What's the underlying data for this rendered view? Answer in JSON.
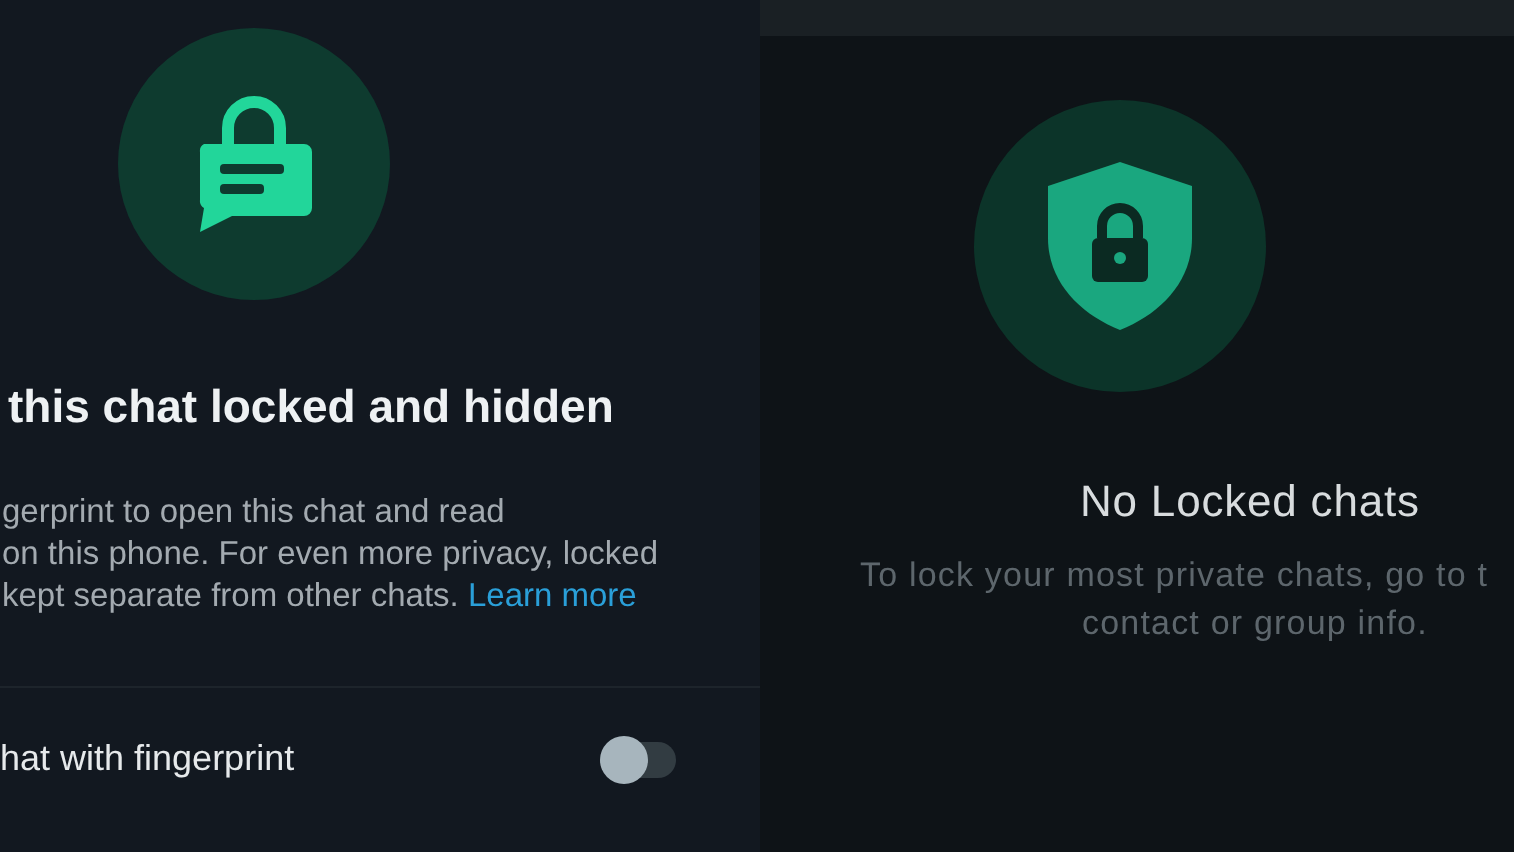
{
  "lock_settings": {
    "title": "this chat locked and hidden",
    "description_lines": [
      "gerprint to open this chat and read",
      "on this phone. For even more privacy, locked",
      "kept separate from other chats."
    ],
    "link": "Learn more",
    "toggle": {
      "label": "hat with fingerprint",
      "on": false
    }
  },
  "locked_chats": {
    "title": "No Locked chats",
    "description_lines": [
      "To lock your most private chats, go to t",
      "contact or group info."
    ]
  }
}
